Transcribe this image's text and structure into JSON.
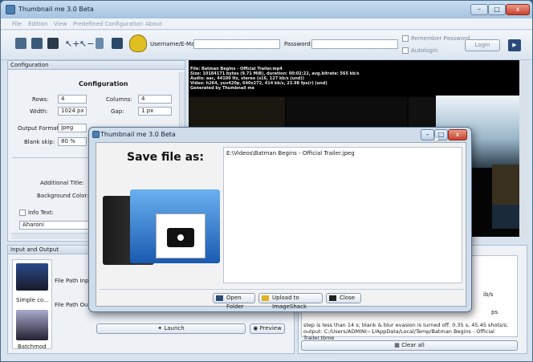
{
  "app": {
    "title": "Thumbnail me 3.0 Beta",
    "window_buttons": [
      "–",
      "□",
      "x"
    ]
  },
  "menu": [
    "File",
    "Edition",
    "View",
    "Predefined Configuration",
    "About"
  ],
  "toolbar": {
    "username_label": "Username/E-Mail:",
    "username_value": "",
    "password_label": "Password:",
    "password_value": "",
    "remember_label": "Remember Password",
    "autologin_label": "Autologin",
    "login_label": "Login",
    "icons": [
      "add-file-icon",
      "open-folder-icon",
      "tray-icon",
      "add-icon",
      "remove-icon",
      "trash-icon",
      "export-icon",
      "frog-icon"
    ]
  },
  "config": {
    "panel_title": "Configuration",
    "section_title": "Configuration",
    "rows_label": "Rows:",
    "rows_value": "4",
    "columns_label": "Columns:",
    "columns_value": "4",
    "width_label": "Width:",
    "width_value": "1024 px",
    "gap_label": "Gap:",
    "gap_value": "1 px",
    "output_format_label": "Output Format:",
    "output_format_value": "jpeg",
    "blank_skip_label": "Blank skip:",
    "blank_skip_value": "80 %",
    "additional_title_label": "Additional Title:",
    "background_color_label": "Background Color:",
    "info_text_label": "Info Text:",
    "font_value": "Aharoni"
  },
  "preview": {
    "lines": [
      "File: Batman Begins - Official Trailer.mp4",
      "Size: 10184171 bytes (9.71 MiB), duration: 00:02:22, avg.bitrate: 565 kb/s",
      "Audio: aac, 44100 Hz, stereo (s16, 127 kb/s (und))",
      "Video: h264, yuv420p, 640x272, 414 kb/s, 23.98 fps(r) (und)",
      "Generated by Thumbnail me"
    ]
  },
  "io": {
    "panel_title": "Input and Output",
    "mode_simple": "Simple co...",
    "mode_batch": "Batchmod",
    "file_path_input_label": "File Path Input:",
    "file_path_output_label": "File Path Output:",
    "launch_label": "Launch",
    "preview_label": "Preview"
  },
  "log": {
    "fragments": [
      "ib/s",
      "ps"
    ],
    "text": "step is less than 14 s; blank & blur evasion is turned off. 0.35 s, 45.45 shots/s; output: C:/Users/ADMINI~1/AppData/Local/Temp/Batman Begins - Official Trailer.tbme",
    "clear_label": "Clear all"
  },
  "dialog": {
    "title": "Thumbnail me 3.0 Beta",
    "save_label": "Save file as:",
    "path": "E:\\Videos\\Batman Begins - Official Trailer.jpeg",
    "open_folder_label": "Open Folder",
    "upload_label": "Upload to ImageShack",
    "close_label": "Close"
  }
}
